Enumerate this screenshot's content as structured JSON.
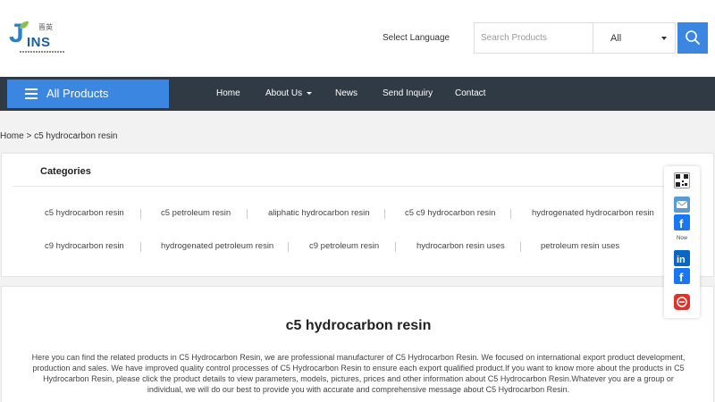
{
  "brand": {
    "logo_text": "INS",
    "logo_letter": "J",
    "logo_cn": "晋英"
  },
  "header": {
    "language_label": "Select Language",
    "search_placeholder": "Search Products",
    "search_scope": "All"
  },
  "nav": {
    "all_products": "All Products",
    "items": [
      "Home",
      "About Us",
      "News",
      "Send Inquiry",
      "Contact"
    ]
  },
  "breadcrumb": {
    "home": "Home",
    "sep": ">",
    "current": "c5 hydrocarbon resin"
  },
  "categories": {
    "title": "Categories",
    "row1": [
      "c5 hydrocarbon resin",
      "c5 petroleum resin",
      "aliphatic hydrocarbon resin",
      "c5 c9 hydrocarbon resin",
      "hydrogenated hydrocarbon resin"
    ],
    "row2": [
      "c9 hydrocarbon resin",
      "hydrogenated petroleum resin",
      "c9 petroleum resin",
      "hydrocarbon resin uses",
      "petroleum resin uses"
    ]
  },
  "description": {
    "title": "c5 hydrocarbon resin",
    "text": "Here you can find the related products in C5 Hydrocarbon Resin, we are professional manufacturer of C5 Hydrocarbon Resin. We focused on international export product development, production and sales. We have improved quality control processes of C5 Hydrocarbon Resin to ensure each export qualified product.If you want to know more about the products in C5 Hydrocarbon Resin, please click the product details to view parameters, models, pictures, prices and other information about C5 Hydrocarbon Resin.Whatever you are a group or individual, we will do our best to provide you with accurate and comprehensive message about C5 Hydrocarbon Resin."
  },
  "share": {
    "now_label": "Now"
  },
  "colors": {
    "accent": "#3a86e0",
    "nav_bg": "#303a45",
    "page_bg": "#f2f2f2"
  }
}
